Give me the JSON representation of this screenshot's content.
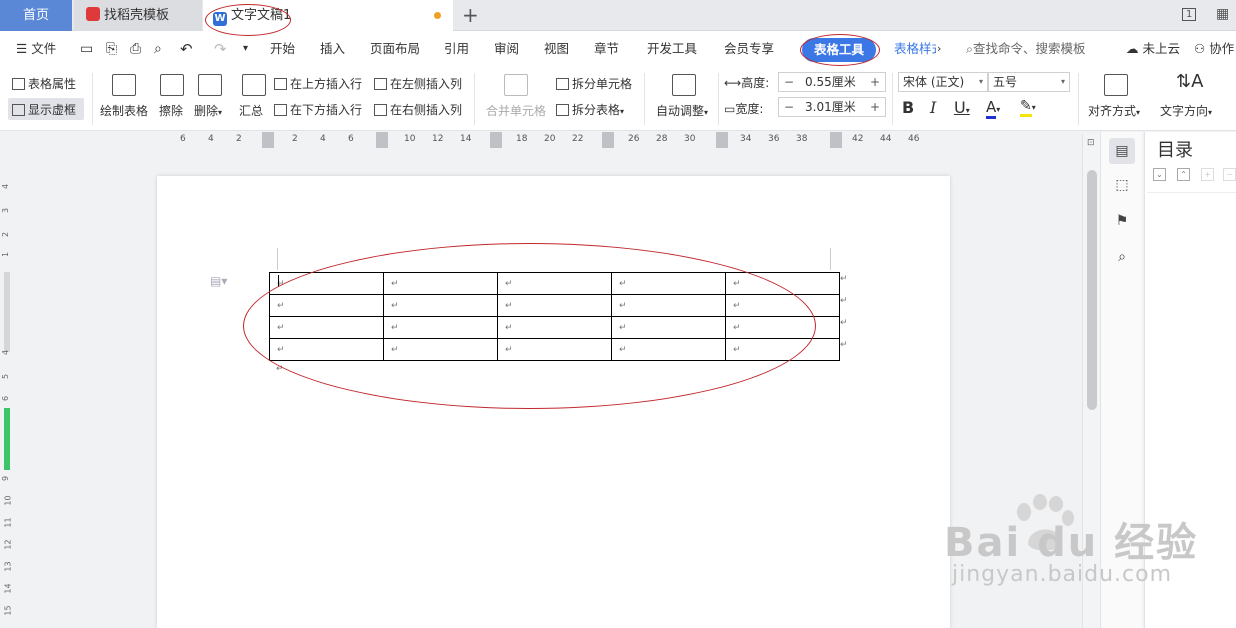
{
  "tabs": {
    "home": "首页",
    "docer": "找稻壳模板",
    "document": "文字文稿1",
    "add": "+"
  },
  "window": {
    "page_indicator": "1"
  },
  "menu": {
    "file": "文件",
    "items": [
      "开始",
      "插入",
      "页面布局",
      "引用",
      "审阅",
      "视图",
      "章节",
      "开发工具",
      "会员专享"
    ],
    "active": "表格工具",
    "next": "表格样式",
    "search_placeholder": "查找命令、搜索模板",
    "cloud": "未上云",
    "collab": "协作"
  },
  "ribbon": {
    "table_properties": "表格属性",
    "show_gridlines": "显示虚框",
    "draw_table": "绘制表格",
    "erase": "擦除",
    "delete": "删除",
    "summary": "汇总",
    "insert_row_above": "在上方插入行",
    "insert_row_below": "在下方插入行",
    "insert_col_left": "在左侧插入列",
    "insert_col_right": "在右侧插入列",
    "merge_cells": "合并单元格",
    "split_cells": "拆分单元格",
    "split_table": "拆分表格",
    "auto_fit": "自动调整",
    "height_label": "高度:",
    "height_value": "0.55厘米",
    "width_label": "宽度:",
    "width_value": "3.01厘米",
    "font": "宋体 (正文)",
    "font_size": "五号",
    "bold": "B",
    "italic": "I",
    "underline": "U",
    "font_color": "A",
    "alignment": "对齐方式",
    "text_direction": "文字方向"
  },
  "ruler": {
    "h_ticks": [
      "6",
      "4",
      "2",
      "2",
      "4",
      "6",
      "10",
      "12",
      "14",
      "18",
      "20",
      "22",
      "26",
      "28",
      "30",
      "34",
      "36",
      "38",
      "42",
      "44",
      "46"
    ],
    "v_ticks": [
      "4",
      "3",
      "2",
      "1",
      "1",
      "4",
      "5",
      "6",
      "7",
      "8",
      "9",
      "10",
      "11",
      "12",
      "13",
      "14",
      "15",
      "16",
      "17"
    ]
  },
  "document": {
    "table": {
      "rows": 4,
      "cols": 5,
      "cell_mark": "↵"
    },
    "return_mark": "↵"
  },
  "toc": {
    "title": "目录"
  },
  "watermark": {
    "brand": "Bai du 经验",
    "url": "jingyan.baidu.com"
  },
  "colors": {
    "accent": "#3b78e6",
    "annotation": "#c0282d",
    "home_tab": "#5a88d6"
  }
}
